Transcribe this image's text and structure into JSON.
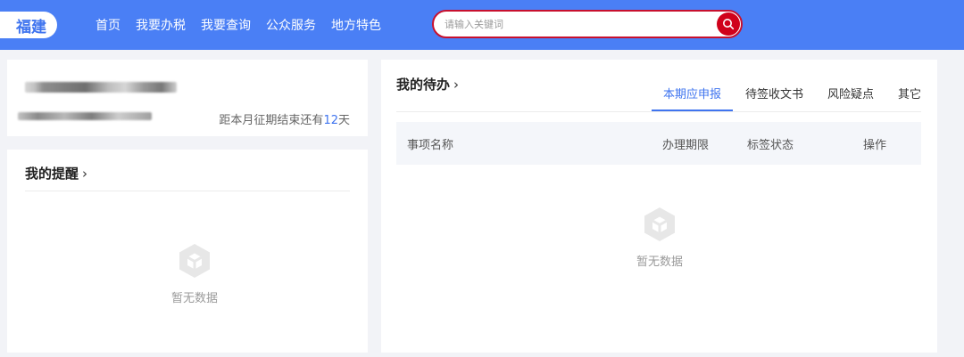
{
  "header": {
    "logo": "福建",
    "nav": [
      "首页",
      "我要办税",
      "我要查询",
      "公众服务",
      "地方特色"
    ],
    "search_placeholder": "请输入关键词"
  },
  "user_card": {
    "deadline_prefix": "距本月征期结束还有",
    "deadline_days": "12",
    "deadline_suffix": "天"
  },
  "reminders": {
    "title": "我的提醒",
    "chevron": "›",
    "empty_text": "暂无数据"
  },
  "todo": {
    "title": "我的待办",
    "chevron": "›",
    "tabs": [
      "本期应申报",
      "待签收文书",
      "风险疑点",
      "其它"
    ],
    "active_tab": "本期应申报",
    "columns": [
      "事项名称",
      "办理期限",
      "标签状态",
      "操作"
    ],
    "empty_text": "暂无数据"
  },
  "colors": {
    "header_bg": "#4a7ff5",
    "accent": "#3f74ef",
    "search_border": "#c8102e",
    "search_button": "#d0021b"
  },
  "icons": {
    "search": "search-icon",
    "empty": "empty-box-icon"
  }
}
